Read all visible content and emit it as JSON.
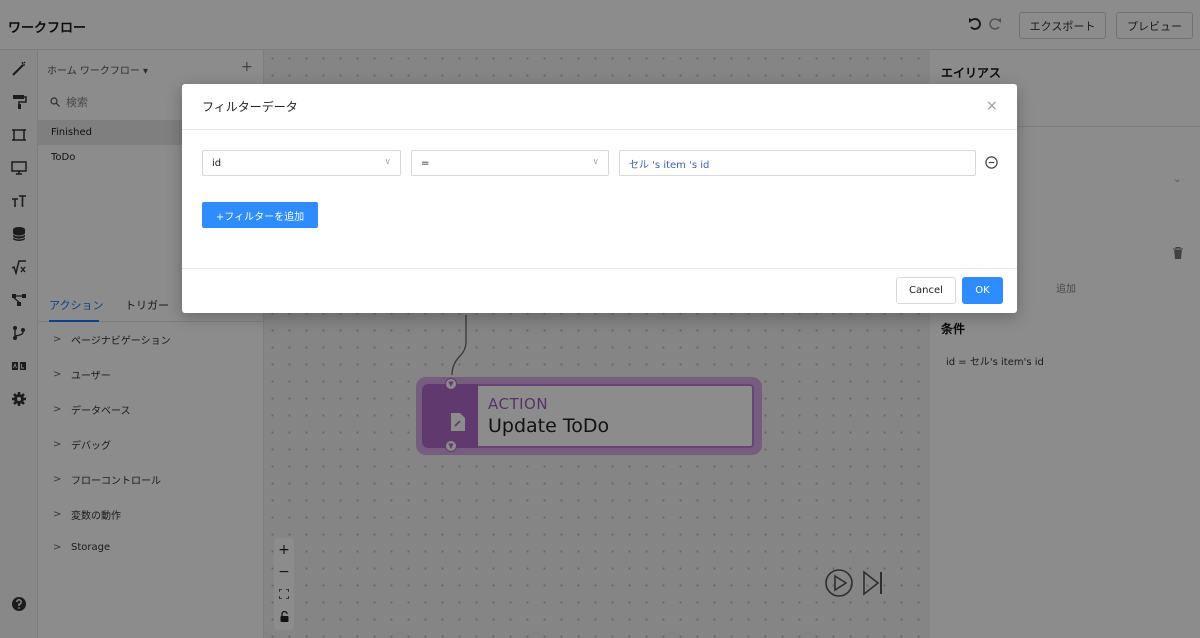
{
  "app": {
    "title": "ワークフロー",
    "export_label": "エクスポート",
    "preview_label": "プレビュー"
  },
  "left_panel": {
    "header": "ホーム ワークフロー ▾",
    "add_symbol": "+",
    "search_placeholder": "検索",
    "workflows": [
      "Finished",
      "ToDo"
    ],
    "tabs": [
      "アクション",
      "トリガー"
    ],
    "categories": [
      "ページナビゲーション",
      "ユーザー",
      "データベース",
      "デバッグ",
      "フローコントロール",
      "変数の動作",
      "Storage"
    ]
  },
  "canvas": {
    "node_label": "ACTION",
    "node_title": "Update ToDo",
    "zoom_in": "+",
    "zoom_out": "−"
  },
  "right_panel": {
    "alias_title": "エイリアス",
    "add_label": "追加",
    "condition_title": "条件",
    "condition_text": "id = セル's item's id"
  },
  "modal": {
    "title": "フィルターデータ",
    "close_symbol": "×",
    "key_value": "id",
    "operator_value": "=",
    "value_text": "セル 's item 's id",
    "add_filter_label": "+フィルターを追加",
    "cancel_label": "Cancel",
    "ok_label": "OK"
  },
  "colors": {
    "accent": "#2e8cff",
    "node_purple": "#b06acb",
    "node_frame": "#d7a8e6",
    "overlay": "rgba(0,0,0,0.45)"
  },
  "icons": [
    "magic-wand-icon",
    "paint-roller-icon",
    "crop-icon",
    "monitor-icon",
    "text-size-icon",
    "database-icon",
    "formula-icon",
    "workflow-icon",
    "branch-icon",
    "ab-test-icon",
    "gear-icon",
    "help-icon"
  ]
}
